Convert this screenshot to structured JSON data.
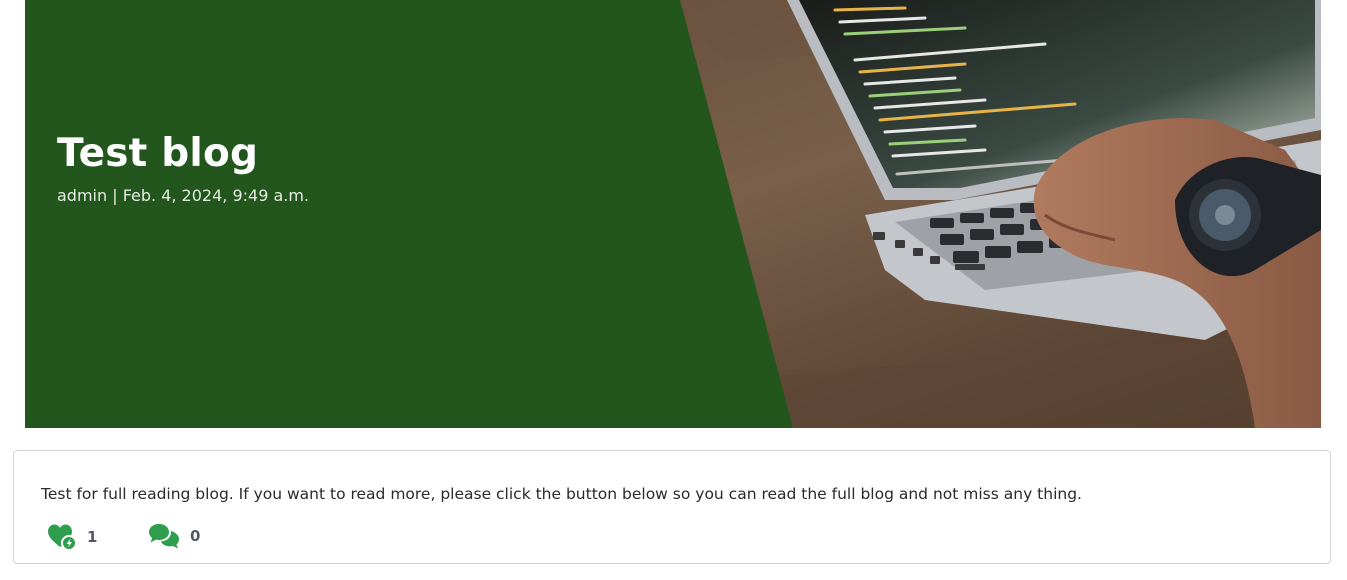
{
  "post": {
    "title": "Test blog",
    "meta": "admin | Feb. 4, 2024, 9:49 a.m.",
    "excerpt": "Test for full reading blog. If you want to read more, please click the button below so you can read the full blog and not miss any thing.",
    "likes": "1",
    "comments": "0"
  },
  "icons": {
    "likes": "heart-bolt-icon",
    "comments": "comments-icon",
    "hero_image": "laptop-code-photo"
  },
  "colors": {
    "hero_green": "#22561c",
    "icon_green": "#2e9e4d"
  }
}
